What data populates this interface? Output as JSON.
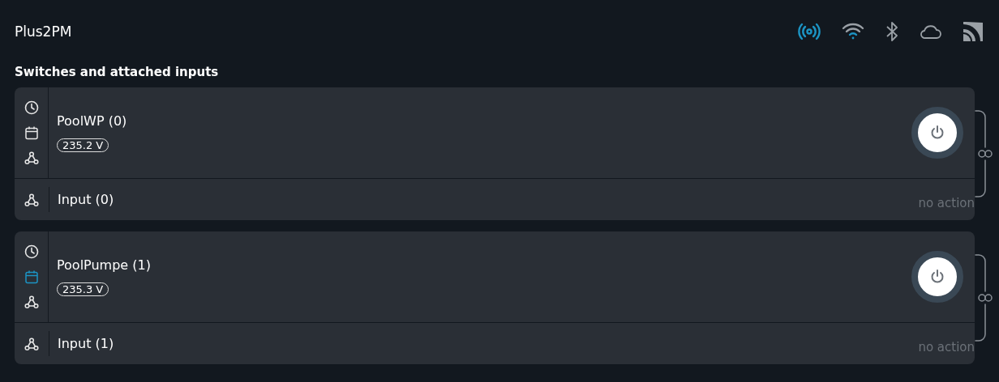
{
  "device": {
    "name": "Plus2PM"
  },
  "status_icons": [
    {
      "kind": "ap",
      "active": true
    },
    {
      "kind": "wifi",
      "active": true
    },
    {
      "kind": "bluetooth",
      "active": false
    },
    {
      "kind": "cloud",
      "active": false
    },
    {
      "kind": "mqtt",
      "active": false
    }
  ],
  "section_title": "Switches and attached inputs",
  "switches": [
    {
      "name": "PoolWP (0)",
      "voltage": "235.2 V",
      "schedule_active": false,
      "on": false,
      "input": {
        "name": "Input (0)",
        "action": "no action"
      }
    },
    {
      "name": "PoolPumpe (1)",
      "voltage": "235.3 V",
      "schedule_active": true,
      "on": false,
      "input": {
        "name": "Input (1)",
        "action": "no action"
      }
    }
  ]
}
